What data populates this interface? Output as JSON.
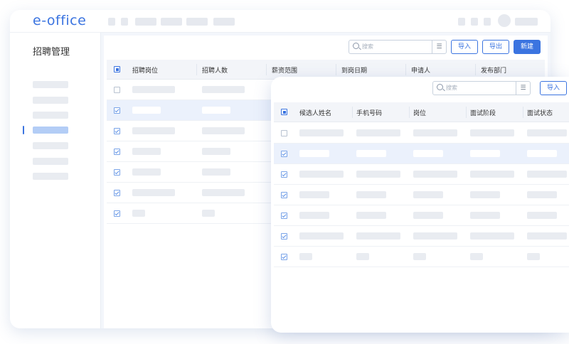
{
  "app": {
    "logo": "e-office"
  },
  "sidebar": {
    "title": "招聘管理",
    "active_index": 3
  },
  "main_table": {
    "search_placeholder": "搜索",
    "filter_icon": "filter-icon",
    "buttons": {
      "import": "导入",
      "export": "导出",
      "create": "新建"
    },
    "columns": [
      "招聘岗位",
      "招聘人数",
      "薪资范围",
      "到岗日期",
      "申请人",
      "发布部门"
    ],
    "rows": [
      {
        "checked": false,
        "highlighted": false
      },
      {
        "checked": true,
        "highlighted": true
      },
      {
        "checked": true,
        "highlighted": false
      },
      {
        "checked": true,
        "highlighted": false
      },
      {
        "checked": true,
        "highlighted": false
      },
      {
        "checked": true,
        "highlighted": false
      },
      {
        "checked": true,
        "highlighted": false
      }
    ]
  },
  "candidate_table": {
    "search_placeholder": "搜索",
    "filter_icon": "filter-icon",
    "buttons": {
      "import": "导入"
    },
    "columns": [
      "候选人姓名",
      "手机号码",
      "岗位",
      "面试阶段",
      "面试状态"
    ],
    "rows": [
      {
        "checked": false,
        "highlighted": false
      },
      {
        "checked": true,
        "highlighted": true
      },
      {
        "checked": true,
        "highlighted": false
      },
      {
        "checked": true,
        "highlighted": false
      },
      {
        "checked": true,
        "highlighted": false
      },
      {
        "checked": true,
        "highlighted": false
      },
      {
        "checked": true,
        "highlighted": false
      }
    ]
  },
  "colors": {
    "accent": "#3b74e0",
    "row_highlight": "#ebf1fc",
    "placeholder_block": "#e9ecf1"
  }
}
